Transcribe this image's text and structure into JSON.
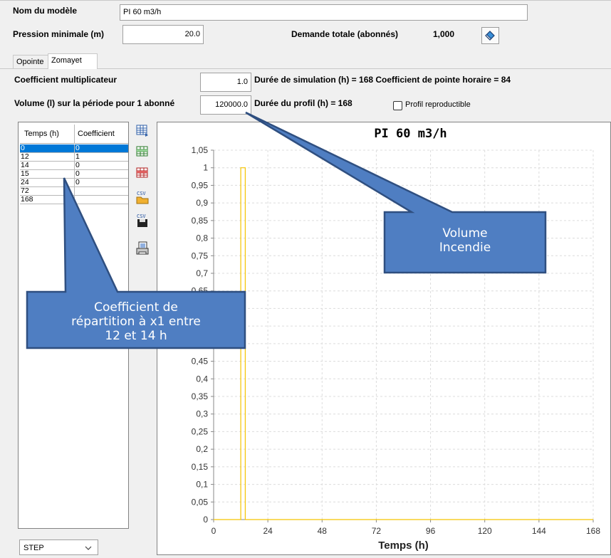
{
  "form": {
    "model_name_label": "Nom du modèle",
    "model_name_value": "PI 60 m3/h",
    "min_pressure_label": "Pression minimale (m)",
    "min_pressure_value": "20.0",
    "total_demand_label": "Demande totale (abonnés)",
    "total_demand_value": "1,000"
  },
  "tabs": [
    {
      "label": "Opointe",
      "active": false
    },
    {
      "label": "Zomayet",
      "active": true
    }
  ],
  "params": {
    "coef_label": "Coefficient multiplicateur",
    "coef_value": "1.0",
    "sim_duration_text": "Durée de simulation (h) = 168 Coefficient de pointe horaire = 84",
    "volume_label": "Volume (l) sur la période pour 1 abonné",
    "volume_value": "120000.0",
    "profile_duration_text": "Durée du profil (h) = 168",
    "reproducible_label": "Profil reproductible",
    "reproducible_checked": false
  },
  "table": {
    "headers": [
      "Temps (h)",
      "Coefficient"
    ],
    "rows": [
      {
        "time": "0",
        "coef": "0"
      },
      {
        "time": "12",
        "coef": "1"
      },
      {
        "time": "14",
        "coef": "0"
      },
      {
        "time": "15",
        "coef": "0"
      },
      {
        "time": "24",
        "coef": "0"
      },
      {
        "time": "72",
        "coef": ""
      },
      {
        "time": "168",
        "coef": ""
      }
    ],
    "selected_row": 0
  },
  "toolbar_icons": [
    "table-add-icon",
    "table-insert-icon",
    "table-delete-icon",
    "csv-import-icon",
    "csv-export-icon",
    "print-icon"
  ],
  "interpolation": {
    "selected": "STEP"
  },
  "callouts": {
    "volume": "Volume\nIncendie",
    "coefficient": "Coefficient de\nrépartition à x1 entre\n12 et 14 h"
  },
  "colors": {
    "series": "#f5c400",
    "callout_fill": "#4f7ec2",
    "callout_border": "#2f4f80",
    "selection": "#0078d7"
  },
  "chart_data": {
    "type": "line",
    "title": "PI 60 m3/h",
    "xlabel": "Temps (h)",
    "ylabel": "",
    "xlim": [
      0,
      168
    ],
    "ylim": [
      0,
      1.05
    ],
    "x_ticks": [
      "0",
      "24",
      "48",
      "72",
      "96",
      "120",
      "144",
      "168"
    ],
    "y_ticks": [
      "0",
      "0,05",
      "0,1",
      "0,15",
      "0,2",
      "0,25",
      "0,3",
      "0,35",
      "0,4",
      "0,45",
      "0,5",
      "0,55",
      "0,6",
      "0,65",
      "0,7",
      "0,75",
      "0,8",
      "0,85",
      "0,9",
      "0,95",
      "1",
      "1,05"
    ],
    "grid": true,
    "series": [
      {
        "values": [
          [
            0,
            0
          ],
          [
            12,
            0
          ],
          [
            12,
            1
          ],
          [
            14,
            1
          ],
          [
            14,
            0
          ],
          [
            168,
            0
          ]
        ]
      }
    ]
  }
}
